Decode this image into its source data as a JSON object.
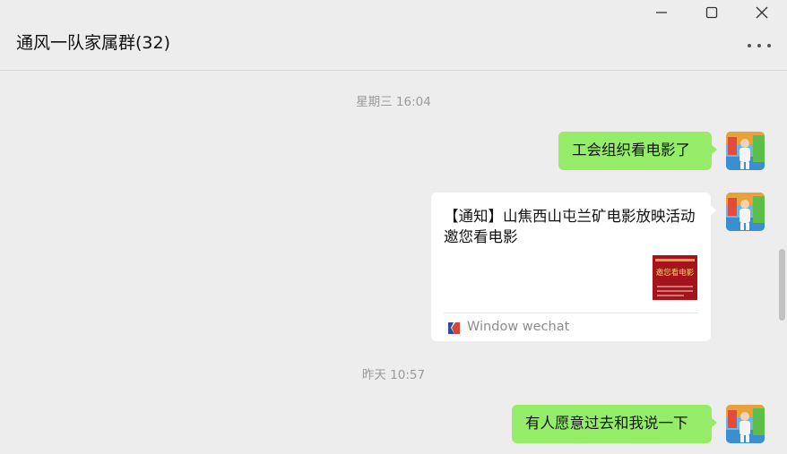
{
  "window": {
    "minimize_icon": "minimize-icon",
    "maximize_icon": "maximize-icon",
    "close_icon": "close-icon"
  },
  "header": {
    "title": "通风一队家属群(32)",
    "more_icon": "more-horizontal-icon"
  },
  "messages": [
    {
      "type": "timestamp",
      "text": "星期三 16:04"
    },
    {
      "type": "text",
      "side": "right",
      "text": "工会组织看电影了"
    },
    {
      "type": "link-card",
      "side": "right",
      "title": "【通知】山焦西山屯兰矿电影放映活动 邀您看电影",
      "thumb_text": "邀您看电影",
      "source": "Window wechat"
    },
    {
      "type": "timestamp",
      "text": "昨天 10:57"
    },
    {
      "type": "text",
      "side": "right",
      "text": "有人愿意过去和我说一下"
    }
  ],
  "colors": {
    "background": "#ededed",
    "outgoing_bubble": "#95ec69",
    "card": "#ffffff",
    "timestamp": "#9a9a9a"
  }
}
